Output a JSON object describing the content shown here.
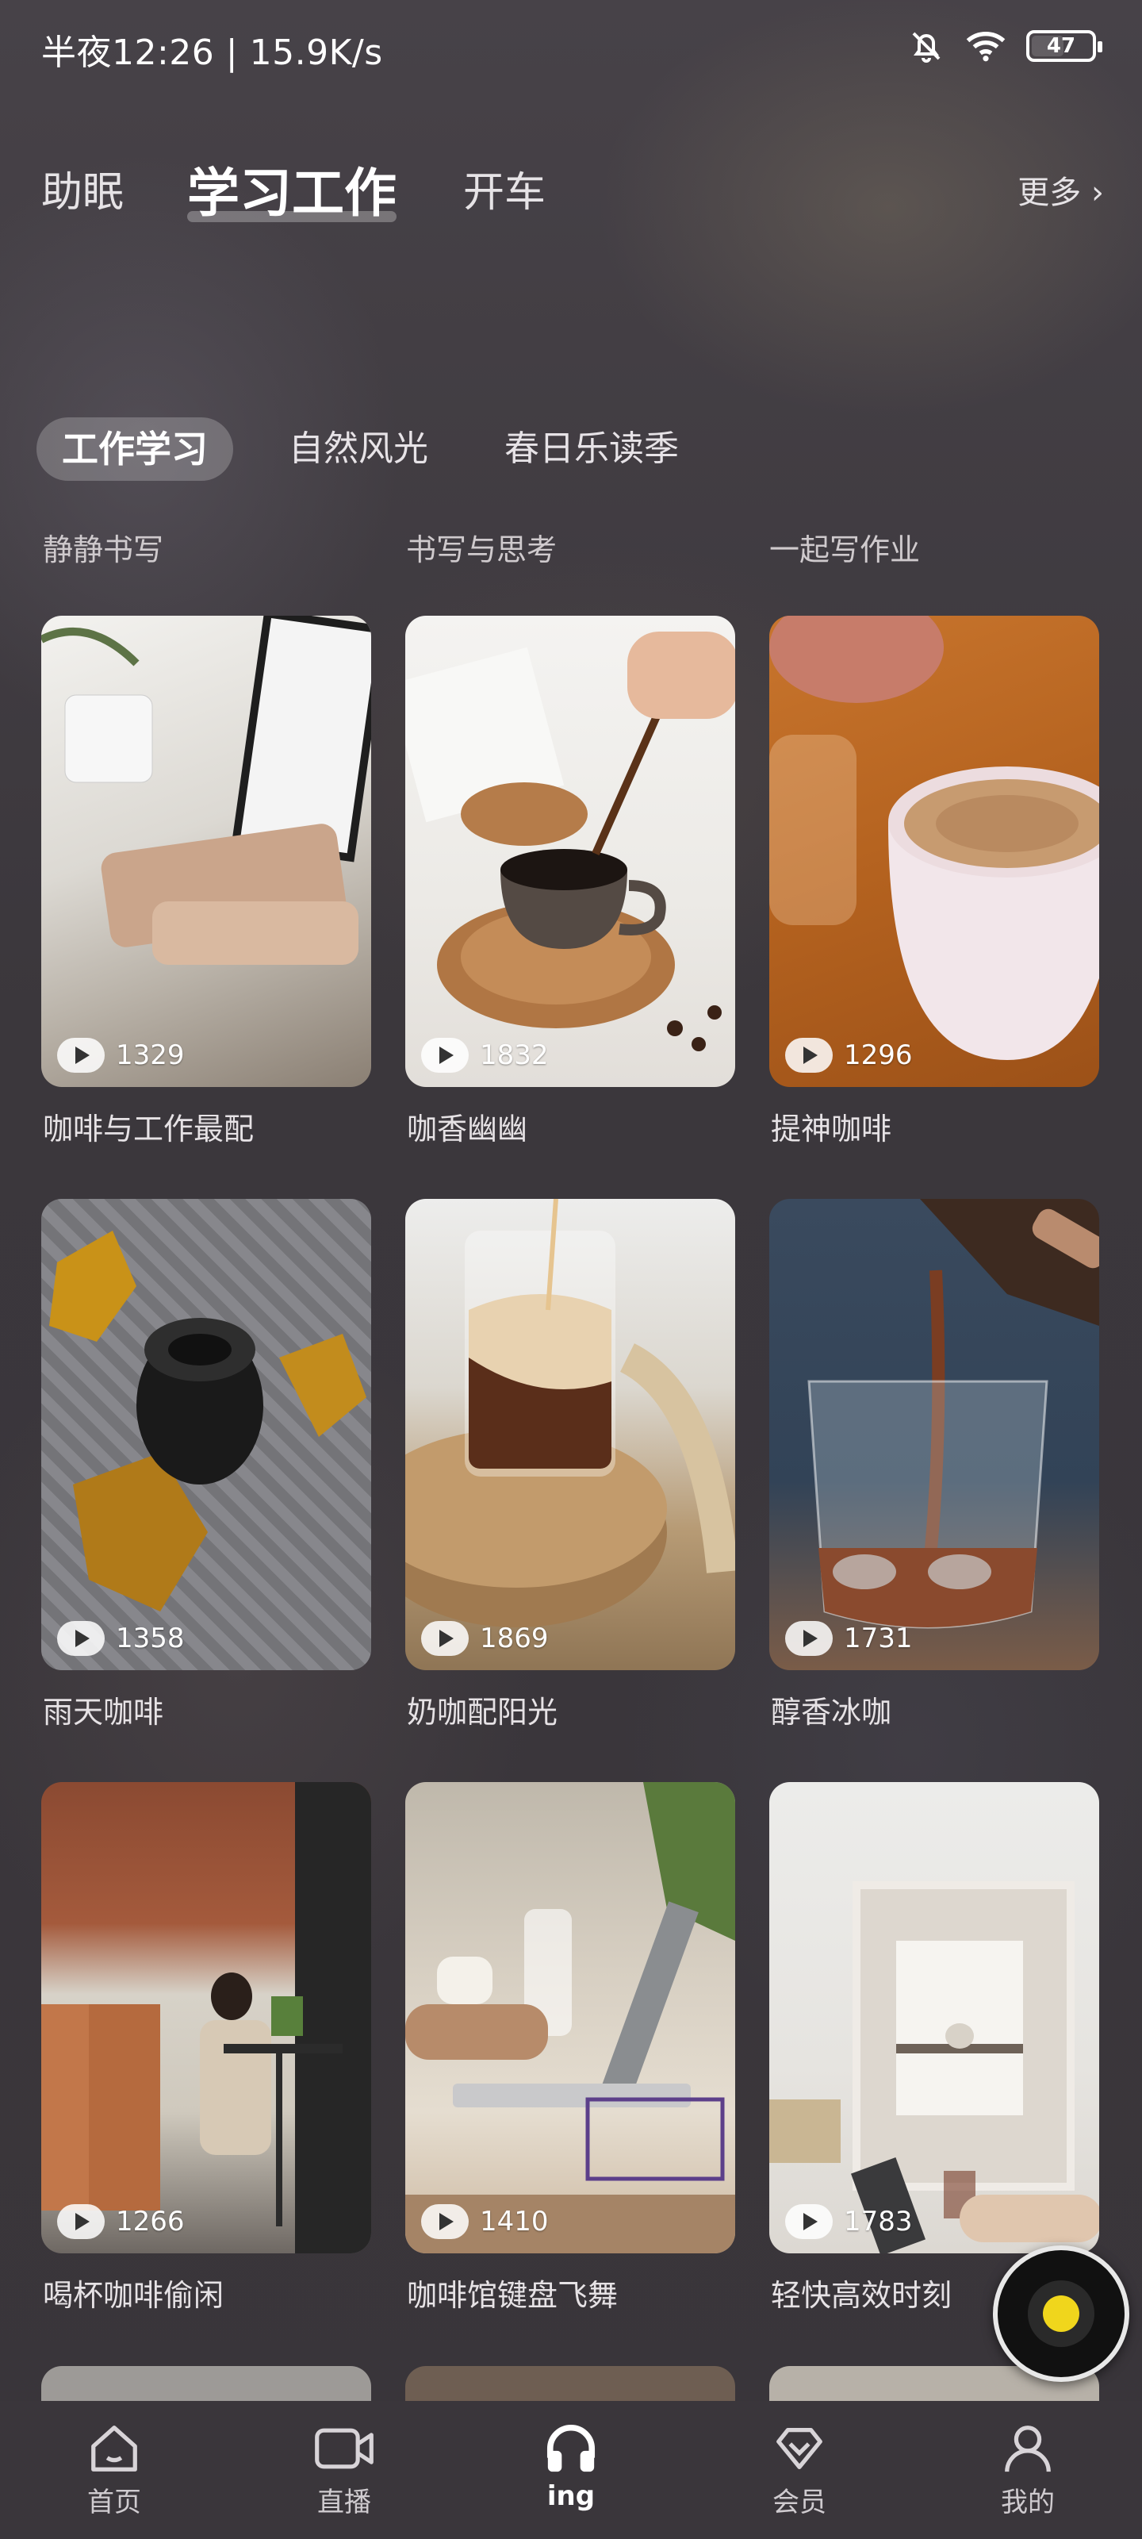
{
  "status_bar": {
    "time_speed": "半夜12:26 | 15.9K/s",
    "battery": "47",
    "icons": [
      "bell-off-icon",
      "wifi-icon",
      "battery-icon"
    ]
  },
  "top_tabs": {
    "items": [
      {
        "label": "助眠"
      },
      {
        "label": "学习工作",
        "active": true
      },
      {
        "label": "开车"
      }
    ],
    "more_label": "更多 ›"
  },
  "sub_tabs": [
    {
      "label": "工作学习",
      "active": true
    },
    {
      "label": "自然风光"
    },
    {
      "label": "春日乐读季"
    }
  ],
  "sections": [
    "静静书写",
    "书写与思考",
    "一起写作业"
  ],
  "cards": [
    {
      "title": "咖啡与工作最配",
      "plays": "1329"
    },
    {
      "title": "咖香幽幽",
      "plays": "1832"
    },
    {
      "title": "提神咖啡",
      "plays": "1296"
    },
    {
      "title": "雨天咖啡",
      "plays": "1358"
    },
    {
      "title": "奶咖配阳光",
      "plays": "1869"
    },
    {
      "title": "醇香冰咖",
      "plays": "1731"
    },
    {
      "title": "喝杯咖啡偷闲",
      "plays": "1266"
    },
    {
      "title": "咖啡馆键盘飞舞",
      "plays": "1410"
    },
    {
      "title": "轻快高效时刻",
      "plays": "1783"
    }
  ],
  "bottom_nav": [
    {
      "label": "首页",
      "icon": "home-icon"
    },
    {
      "label": "直播",
      "icon": "video-icon"
    },
    {
      "label": "ing",
      "icon": "headphones-icon",
      "active": true
    },
    {
      "label": "会员",
      "icon": "vip-diamond-icon"
    },
    {
      "label": "我的",
      "icon": "person-icon"
    }
  ]
}
